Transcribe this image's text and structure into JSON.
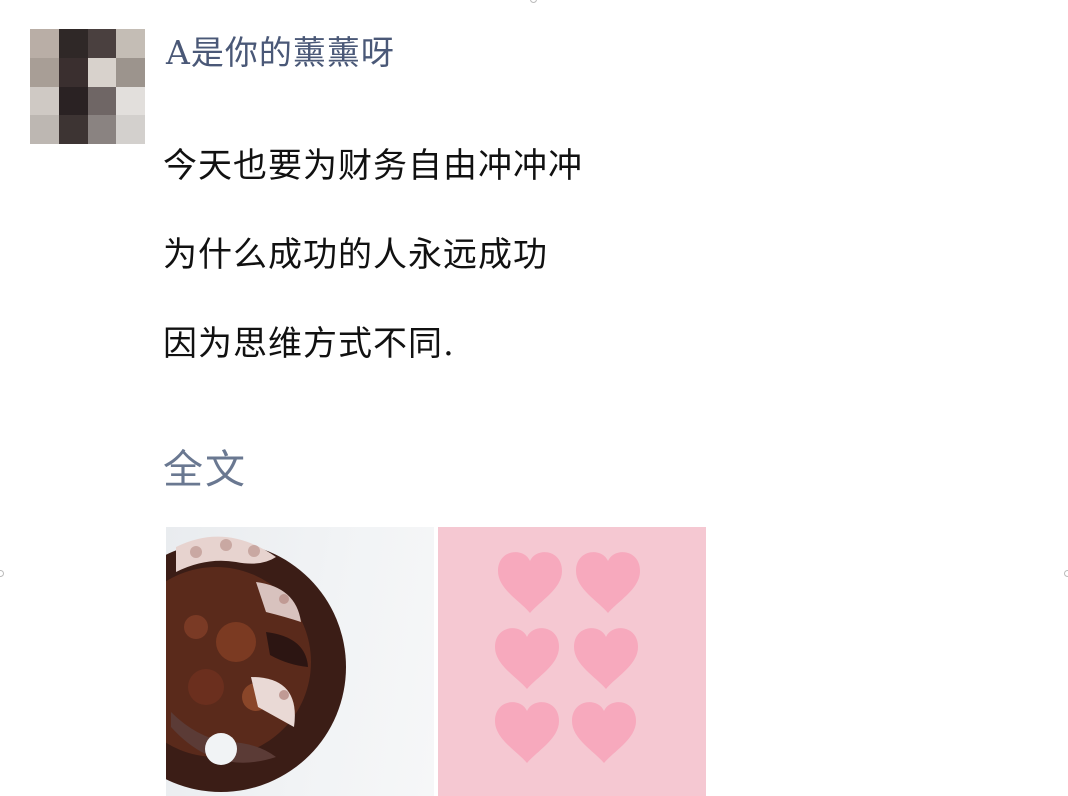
{
  "post": {
    "author_name": "A是你的薰薰呀",
    "lines": [
      "今天也要为财务自由冲冲冲",
      "为什么成功的人永远成功",
      "因为思维方式不同."
    ],
    "full_text_link": "全文"
  },
  "images": [
    {
      "icon": "octopus-dish-photo"
    },
    {
      "icon": "pink-hearts-photo"
    }
  ],
  "colors": {
    "author_name": "#4a5877",
    "body_text": "#111111",
    "full_text_link": "#6a7891",
    "background": "#ffffff"
  }
}
